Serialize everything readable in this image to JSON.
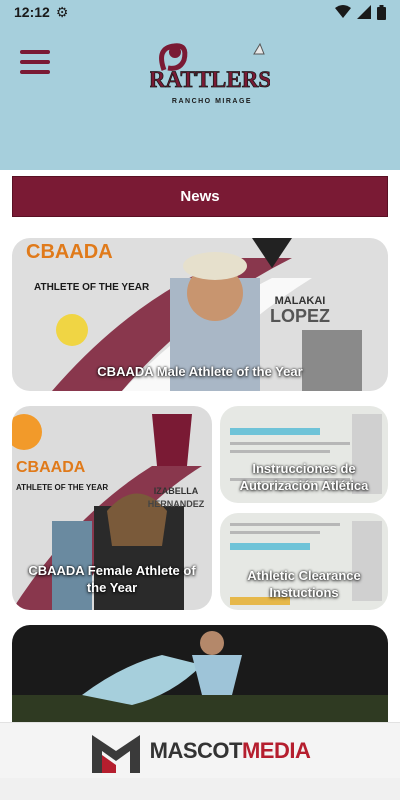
{
  "status": {
    "time": "12:12",
    "icons": [
      "gear-icon",
      "wifi-icon",
      "signal-icon",
      "battery-icon"
    ]
  },
  "header": {
    "brand_main": "RATTLERS",
    "brand_sub": "RANCHO MIRAGE"
  },
  "news": {
    "title": "News"
  },
  "cards": [
    {
      "caption": "CBAADA Male Athlete of the Year",
      "overlay_top": "CBAADA",
      "overlay_sub": "ATHLETE OF THE YEAR",
      "overlay_name1": "MALAKAI",
      "overlay_name2": "LOPEZ"
    },
    {
      "caption": "CBAADA Female Athlete of the Year",
      "overlay_top": "CBAADA",
      "overlay_sub": "ATHLETE OF THE YEAR",
      "overlay_name1": "IZABELLA",
      "overlay_name2": "HERNANDEZ"
    },
    {
      "caption": "Instrucciones de Autorización Atlética"
    },
    {
      "caption": "Athletic Clearance Instuctions"
    },
    {
      "caption": ""
    }
  ],
  "footer": {
    "brand_a": "MASCOT",
    "brand_b": "MEDIA"
  },
  "colors": {
    "header": "#a6cfdc",
    "maroon": "#7a1a34",
    "footer_red": "#b51e2e"
  }
}
